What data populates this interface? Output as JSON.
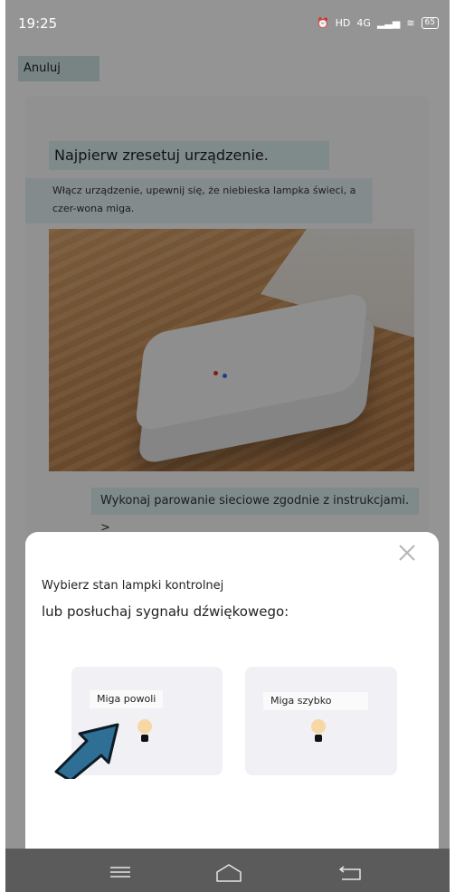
{
  "status_bar": {
    "time": "19:25",
    "network": "4G",
    "battery": "65"
  },
  "header": {
    "cancel_label": "Anuluj"
  },
  "instructions": {
    "title": "Najpierw zresetuj urządzenie.",
    "body": "Włącz urządzenie, upewnij się, że niebieska lampka świeci, a czer-wona miga.",
    "pair_link": "Wykonaj parowanie sieciowe zgodnie z instrukcjami. >"
  },
  "sheet": {
    "prompt_line1": "Wybierz stan lampki kontrolnej",
    "prompt_line2": "lub posłuchaj sygnału dźwiękowego:",
    "options": [
      {
        "label": "Miga powoli"
      },
      {
        "label": "Miga szybko"
      }
    ]
  },
  "colors": {
    "highlight": "#dbeef0",
    "arrow": "#2f6f95",
    "bulb": "#f7d7a4"
  }
}
